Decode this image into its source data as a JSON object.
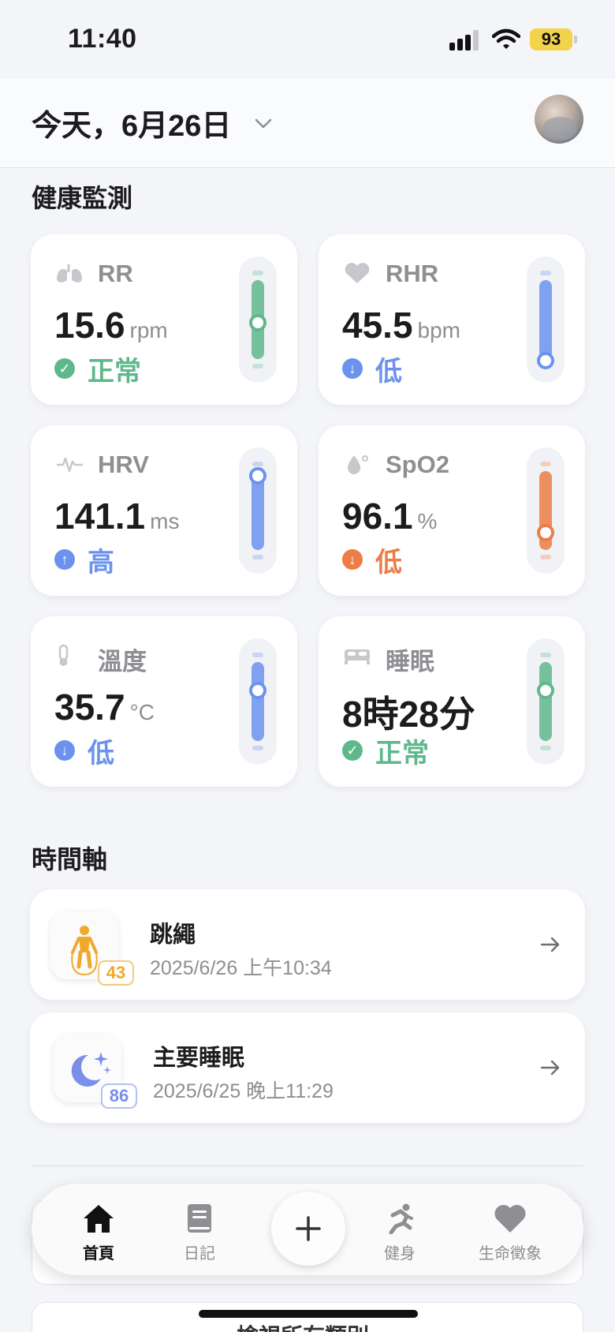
{
  "status_bar": {
    "time": "11:40",
    "battery": "93"
  },
  "header": {
    "title": "今天，6月26日",
    "chevron_icon": "chevron-down-icon",
    "avatar_icon": "avatar"
  },
  "health": {
    "section_title": "健康監測",
    "cards": [
      {
        "label": "RR",
        "value": "15.6",
        "unit": "rpm",
        "status": "正常",
        "icon": "lungs-icon",
        "status_icon": "check-icon",
        "color": "#5fb88b",
        "level": 0.55
      },
      {
        "label": "RHR",
        "value": "45.5",
        "unit": "bpm",
        "status": "低",
        "icon": "heart-icon",
        "status_icon": "arrow-down-icon",
        "color": "#6b93ee",
        "level": 0.15
      },
      {
        "label": "HRV",
        "value": "141.1",
        "unit": "ms",
        "status": "高",
        "icon": "pulse-icon",
        "status_icon": "arrow-up-icon",
        "color": "#6b93ee",
        "level": 0.95
      },
      {
        "label": "SpO2",
        "value": "96.1",
        "unit": "%",
        "status": "低",
        "icon": "droplet-icon",
        "status_icon": "arrow-down-icon",
        "color": "#ec7d47",
        "level": 0.35
      },
      {
        "label": "溫度",
        "value": "35.7",
        "unit": "°C",
        "status": "低",
        "icon": "thermometer-icon",
        "status_icon": "arrow-down-icon",
        "color": "#6b93ee",
        "level": 0.7
      },
      {
        "label": "睡眠",
        "value": "8時28分",
        "unit": "",
        "status": "正常",
        "icon": "bed-icon",
        "status_icon": "check-icon",
        "color": "#5fb88b",
        "level": 0.7
      }
    ]
  },
  "timeline": {
    "section_title": "時間軸",
    "items": [
      {
        "title": "跳繩",
        "time": "2025/6/26 上午10:34",
        "score": "43",
        "icon": "jump-rope-icon",
        "color": "#f0a92b"
      },
      {
        "title": "主要睡眠",
        "time": "2025/6/25 晚上11:29",
        "score": "86",
        "icon": "moon-stars-icon",
        "color": "#7a8fea"
      }
    ]
  },
  "tab_bar": {
    "items": [
      {
        "label": "首頁",
        "icon": "home-icon",
        "active": true
      },
      {
        "label": "日記",
        "icon": "book-icon",
        "active": false
      },
      {
        "label": "健身",
        "icon": "running-icon",
        "active": false
      },
      {
        "label": "生命徵象",
        "icon": "heart-icon",
        "active": false
      }
    ],
    "add_icon": "plus-icon"
  },
  "footer_peek": "檢視所有類別"
}
